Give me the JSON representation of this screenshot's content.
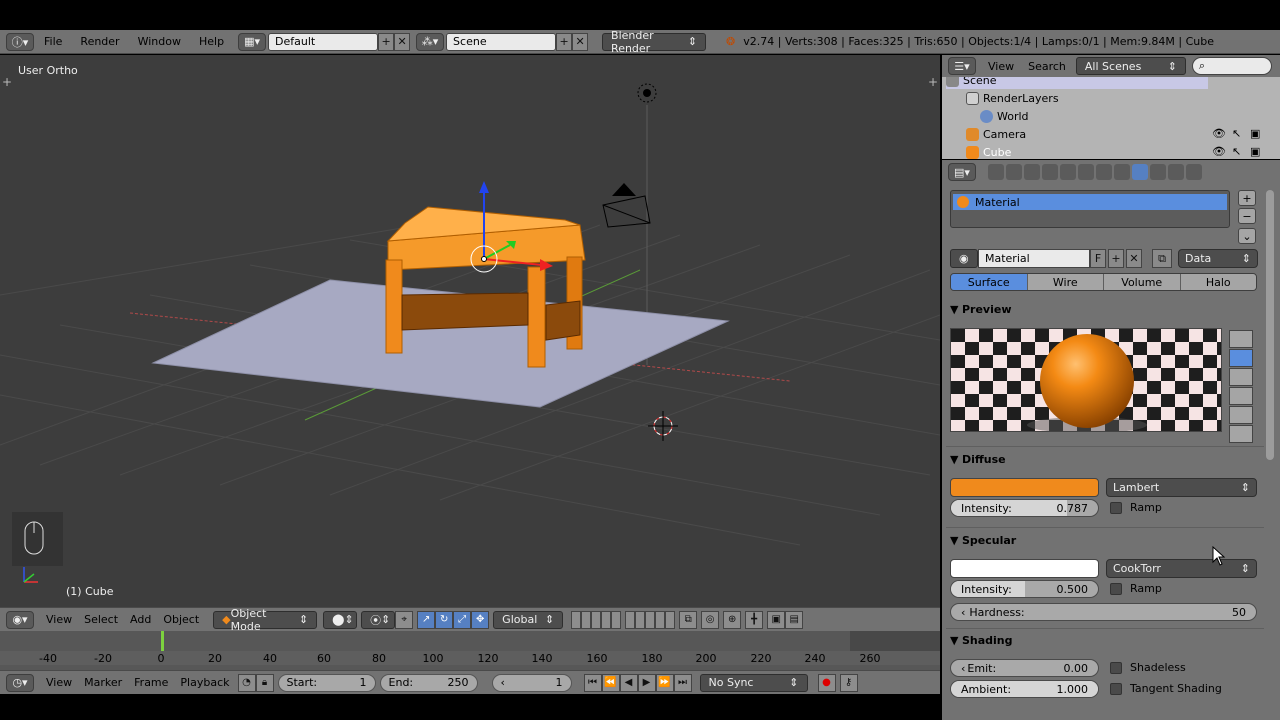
{
  "topbar": {
    "menus": [
      "File",
      "Render",
      "Window",
      "Help"
    ],
    "screen_layout": "Default",
    "scene": "Scene",
    "render_engine": "Blender Render",
    "stats": "v2.74 | Verts:308 | Faces:325 | Tris:650 | Objects:1/4 | Lamps:0/1 | Mem:9.84M | Cube"
  },
  "viewport": {
    "view_label": "User Ortho",
    "object_label": "(1) Cube"
  },
  "viewport_header": {
    "menus": [
      "View",
      "Select",
      "Add",
      "Object"
    ],
    "mode": "Object Mode",
    "orientation": "Global"
  },
  "timeline": {
    "ticks": [
      "-40",
      "-20",
      "0",
      "20",
      "40",
      "60",
      "80",
      "100",
      "120",
      "140",
      "160",
      "180",
      "200",
      "220",
      "240",
      "260"
    ],
    "menus": [
      "View",
      "Marker",
      "Frame",
      "Playback"
    ],
    "start_label": "Start:",
    "start_value": "1",
    "end_label": "End:",
    "end_value": "250",
    "current_frame": "1",
    "sync": "No Sync"
  },
  "outliner": {
    "menus": [
      "View",
      "Search"
    ],
    "filter": "All Scenes",
    "items": [
      "Scene",
      "RenderLayers",
      "World",
      "Camera",
      "Cube"
    ]
  },
  "properties": {
    "material_slot": "Material",
    "material_name": "Material",
    "fake_user": "F",
    "link": "Data",
    "tabs": [
      "Surface",
      "Wire",
      "Volume",
      "Halo"
    ],
    "preview_title": "Preview",
    "diffuse": {
      "title": "Diffuse",
      "color": "#f08a1c",
      "shader": "Lambert",
      "intensity_label": "Intensity:",
      "intensity": "0.787",
      "ramp": "Ramp"
    },
    "specular": {
      "title": "Specular",
      "color": "#ffffff",
      "shader": "CookTorr",
      "intensity_label": "Intensity:",
      "intensity": "0.500",
      "ramp": "Ramp",
      "hardness_label": "Hardness:",
      "hardness": "50"
    },
    "shading": {
      "title": "Shading",
      "emit_label": "Emit:",
      "emit": "0.00",
      "ambient_label": "Ambient:",
      "ambient": "1.000",
      "shadeless": "Shadeless",
      "tangent": "Tangent Shading"
    }
  },
  "colors": {
    "accent": "#5680c2",
    "object_orange": "#f08a1c",
    "viewport_bg": "#3d3d3d",
    "header_bg": "#727272"
  }
}
